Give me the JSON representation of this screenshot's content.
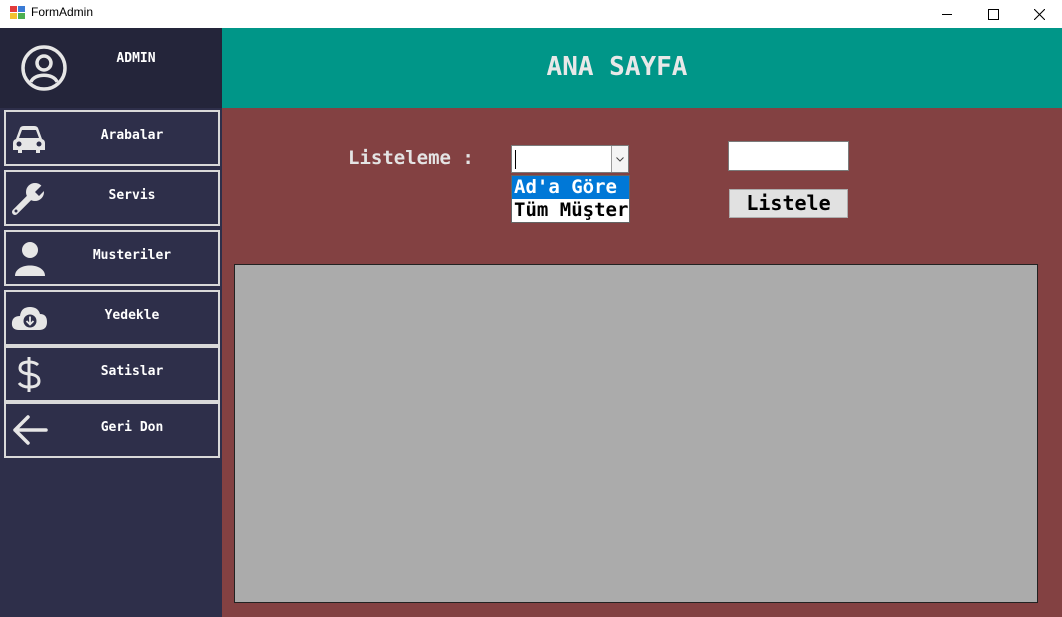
{
  "window": {
    "title": "FormAdmin",
    "controls": {
      "minimize": "minimize-icon",
      "maximize": "maximize-icon",
      "close": "close-icon"
    }
  },
  "sidebar": {
    "user_label": "ADMIN",
    "user_icon": "user-circle-icon",
    "items": [
      {
        "label": "Arabalar",
        "icon": "car-icon"
      },
      {
        "label": "Servis",
        "icon": "wrench-icon"
      },
      {
        "label": "Musteriler",
        "icon": "person-icon"
      },
      {
        "label": "Yedekle",
        "icon": "cloud-download-icon"
      },
      {
        "label": "Satislar",
        "icon": "dollar-icon"
      },
      {
        "label": "Geri Don",
        "icon": "arrow-left-icon"
      }
    ]
  },
  "header": {
    "title": "ANA SAYFA"
  },
  "filter": {
    "label": "Listeleme :",
    "combo_value": "",
    "options": [
      "Ad'a Göre",
      "Tüm Müşter"
    ],
    "selected_option": "Ad'a Göre",
    "search_value": "",
    "button_label": "Listele"
  },
  "colors": {
    "sidebar": "#2e2f4a",
    "sidebar_header": "#24253a",
    "header": "#009688",
    "main": "#834142",
    "grid": "#ababab",
    "selection": "#0078d7"
  }
}
